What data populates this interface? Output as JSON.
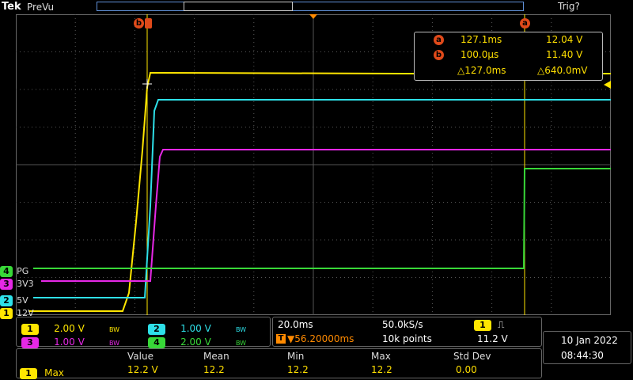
{
  "header": {
    "logo": "Tek",
    "mode": "PreVu",
    "trigger_status": "Trig?"
  },
  "colors": {
    "ch1": "#ffe600",
    "ch2": "#2ee0e8",
    "ch3": "#e628e6",
    "ch4": "#38d838",
    "cursor": "#e04a1a",
    "grid": "#555555"
  },
  "cursors": {
    "a": {
      "marker": "a",
      "time": "127.1ms",
      "volt": "12.04 V"
    },
    "b": {
      "marker": "b",
      "time": "100.0µs",
      "volt": "11.40 V"
    },
    "delta_time": "△127.0ms",
    "delta_volt": "△640.0mV"
  },
  "channels": [
    {
      "num": "1",
      "label": "12V",
      "scale": "2.00 V",
      "bw": "BW"
    },
    {
      "num": "2",
      "label": "5V",
      "scale": "1.00 V",
      "bw": "BW"
    },
    {
      "num": "3",
      "label": "3V3",
      "scale": "1.00 V",
      "bw": "BW"
    },
    {
      "num": "4",
      "label": "PG",
      "scale": "2.00 V",
      "bw": "BW"
    }
  ],
  "timebase": {
    "scale": "20.0ms",
    "sample_rate": "50.0kS/s",
    "trigger_delay": "▼56.20000ms",
    "record_length": "10k points"
  },
  "trigger": {
    "source": "1",
    "slope": "⎍",
    "level": "11.2 V"
  },
  "measurements": {
    "headers": [
      "Value",
      "Mean",
      "Min",
      "Max",
      "Std Dev"
    ],
    "rows": [
      {
        "source": "1",
        "name": "Max",
        "value": "12.2 V",
        "mean": "12.2",
        "min": "12.2",
        "max": "12.2",
        "std_dev": "0.00"
      }
    ]
  },
  "datetime": {
    "date": "10 Jan  2022",
    "time": "08:44:30"
  }
}
